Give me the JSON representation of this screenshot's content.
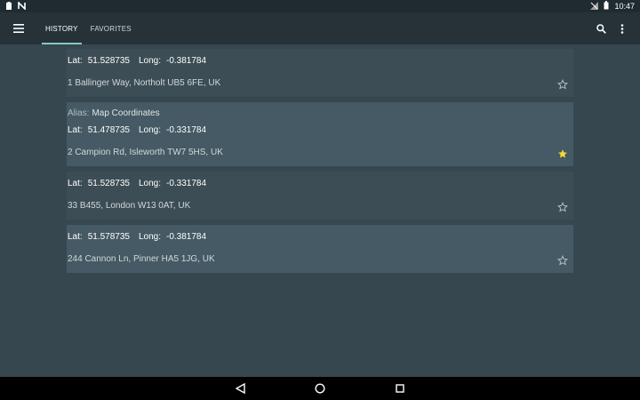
{
  "status_bar": {
    "time": "10:47",
    "left_icons": [
      "clipboard-icon",
      "notification-n-icon"
    ],
    "right_icons": [
      "signal-off-icon",
      "battery-icon"
    ]
  },
  "app_bar": {
    "tabs": [
      {
        "label": "HISTORY",
        "active": true
      },
      {
        "label": "FAVORITES",
        "active": false
      }
    ],
    "actions": [
      "search-icon",
      "more-vert-icon"
    ]
  },
  "history": [
    {
      "lat_label": "Lat:",
      "lat": "51.528735",
      "long_label": "Long:",
      "long": "-0.381784",
      "address": "1 Ballinger Way, Northolt UB5 6FE, UK",
      "favorite": false
    },
    {
      "alias_label": "Alias:",
      "alias": "Map Coordinates",
      "lat_label": "Lat:",
      "lat": "51.478735",
      "long_label": "Long:",
      "long": "-0.331784",
      "address": "2 Campion Rd, Isleworth TW7 5HS, UK",
      "favorite": true
    },
    {
      "lat_label": "Lat:",
      "lat": "51.528735",
      "long_label": "Long:",
      "long": "-0.331784",
      "address": "33 B455, London W13 0AT, UK",
      "favorite": false
    },
    {
      "lat_label": "Lat:",
      "lat": "51.578735",
      "long_label": "Long:",
      "long": "-0.381784",
      "address": "244 Cannon Ln, Pinner HA5 1JG, UK",
      "favorite": false
    }
  ],
  "colors": {
    "accent": "#80cbc4",
    "star_active": "#fdd835",
    "star_inactive": "#b0bec5"
  }
}
